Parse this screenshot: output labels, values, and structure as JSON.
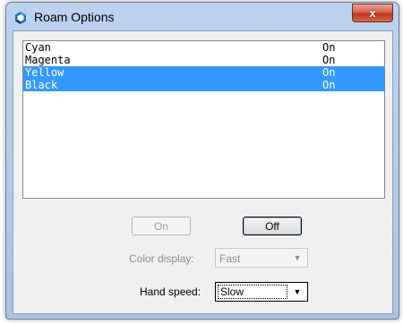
{
  "window": {
    "title": "Roam Options",
    "close_glyph": "x"
  },
  "list": {
    "rows": [
      {
        "name": "Cyan",
        "state": "On",
        "selected": false
      },
      {
        "name": "Magenta",
        "state": "On",
        "selected": false
      },
      {
        "name": "Yellow",
        "state": "On",
        "selected": true
      },
      {
        "name": "Black",
        "state": "On",
        "selected": true
      }
    ]
  },
  "buttons": {
    "on_label": "On",
    "off_label": "Off"
  },
  "color_display": {
    "label": "Color display:",
    "value": "Fast"
  },
  "hand_speed": {
    "label": "Hand speed:",
    "value": "Slow"
  },
  "icons": {
    "app": "roam-app-icon",
    "dropdown": "chevron-down-icon"
  },
  "colors": {
    "selection": "#3399ff",
    "close": "#c0331c"
  }
}
